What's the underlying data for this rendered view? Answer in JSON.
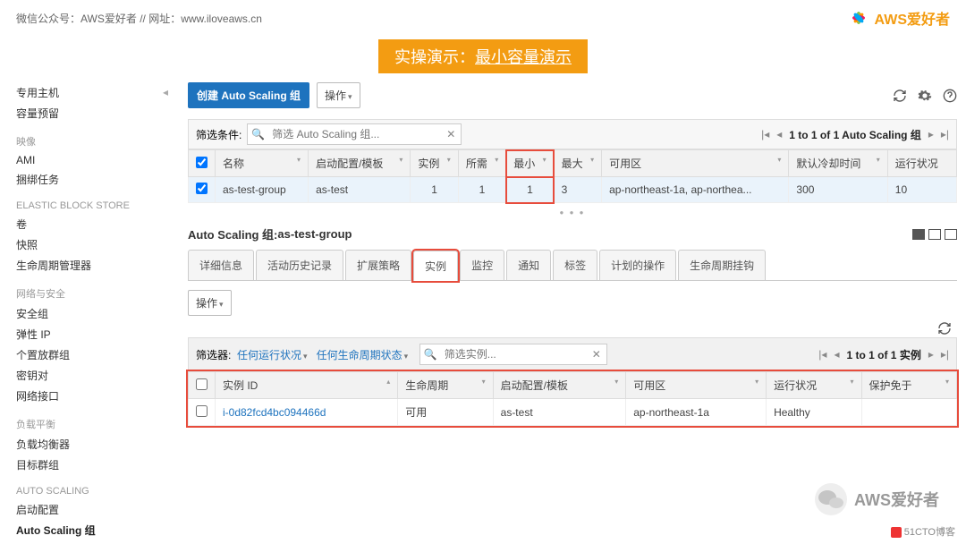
{
  "header": {
    "left_text": "微信公众号：AWS爱好者  //  网址：www.iloveaws.cn",
    "brand": "AWS爱好者"
  },
  "banner": {
    "prefix": "实操演示：",
    "underlined": "最小容量演示"
  },
  "sidebar": {
    "items1": [
      "专用主机",
      "容量预留"
    ],
    "head1": "映像",
    "items2": [
      "AMI",
      "捆绑任务"
    ],
    "head2": "ELASTIC BLOCK STORE",
    "items3": [
      "卷",
      "快照",
      "生命周期管理器"
    ],
    "head3": "网络与安全",
    "items4": [
      "安全组",
      "弹性 IP",
      "个置放群组",
      "密钥对",
      "网络接口"
    ],
    "head4": "负载平衡",
    "items5": [
      "负载均衡器",
      "目标群组"
    ],
    "head5": "AUTO SCALING",
    "items6": [
      "启动配置",
      "Auto Scaling 组"
    ]
  },
  "toolbar": {
    "create_btn": "创建 Auto Scaling 组",
    "actions_btn": "操作"
  },
  "filter": {
    "label": "筛选条件:",
    "placeholder": "筛选 Auto Scaling 组...",
    "pager": "1 to 1 of 1 Auto Scaling 组"
  },
  "cols": [
    "名称",
    "启动配置/模板",
    "实例",
    "所需",
    "最小",
    "最大",
    "可用区",
    "默认冷却时间",
    "运行状况"
  ],
  "row": {
    "name": "as-test-group",
    "launch": "as-test",
    "inst": "1",
    "desired": "1",
    "min": "1",
    "max": "3",
    "az": "ap-northeast-1a, ap-northea...",
    "cooldown": "300",
    "health": "10"
  },
  "panel": {
    "title_prefix": "Auto Scaling 组: ",
    "title_name": "as-test-group"
  },
  "tabs": [
    "详细信息",
    "活动历史记录",
    "扩展策略",
    "实例",
    "监控",
    "通知",
    "标签",
    "计划的操作",
    "生命周期挂钩"
  ],
  "subtoolbar": {
    "actions": "操作"
  },
  "filter2": {
    "label": "筛选器:",
    "any_health": "任何运行状况",
    "any_life": "任何生命周期状态",
    "placeholder": "筛选实例...",
    "pager": "1 to 1 of 1 实例"
  },
  "cols2": [
    "实例 ID",
    "生命周期",
    "启动配置/模板",
    "可用区",
    "运行状况",
    "保护免于"
  ],
  "row2": {
    "id": "i-0d82fcd4bc094466d",
    "life": "可用",
    "launch": "as-test",
    "az": "ap-northeast-1a",
    "health": "Healthy",
    "protect": ""
  },
  "watermark": "AWS爱好者",
  "credit": "51CTO博客"
}
